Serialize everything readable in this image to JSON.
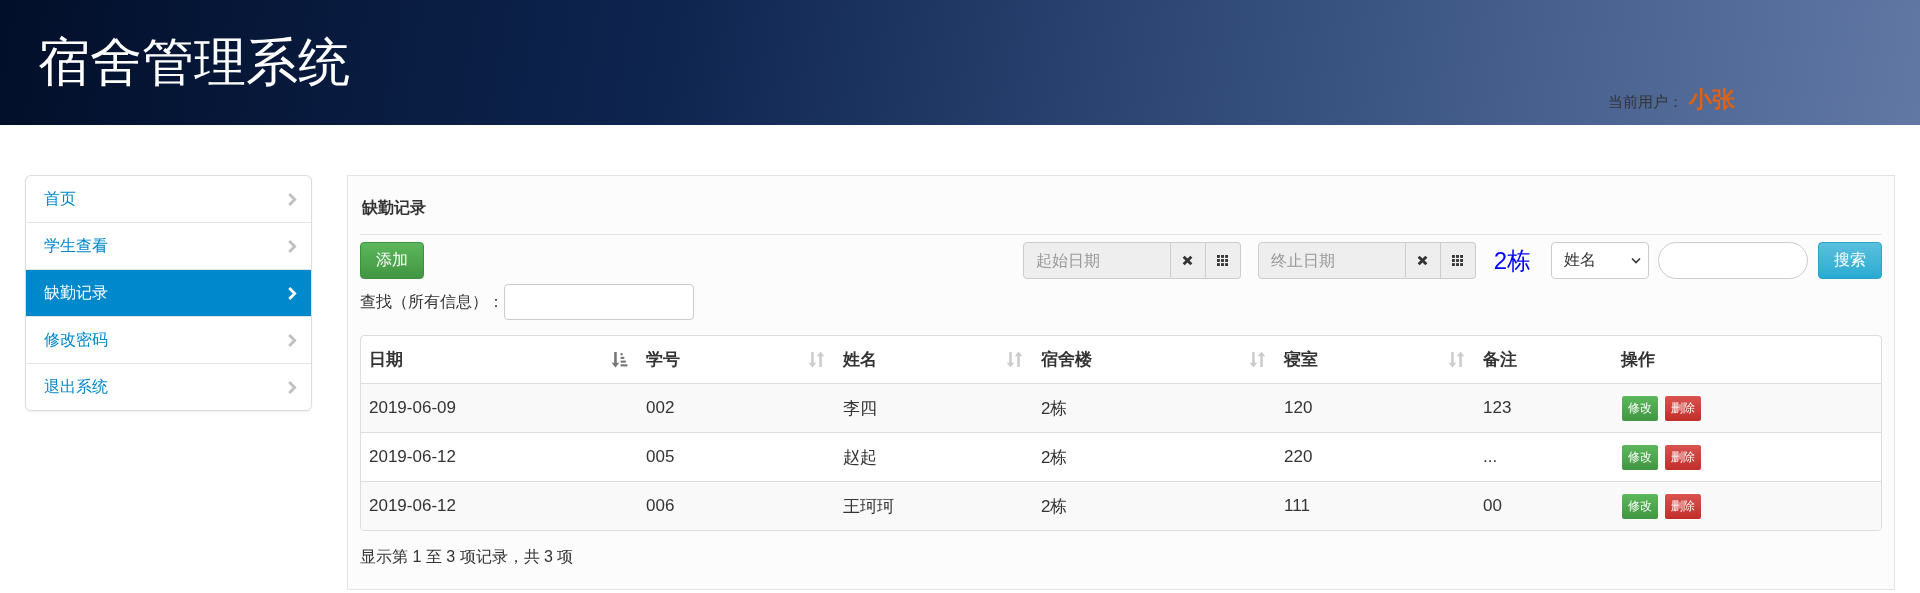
{
  "header": {
    "title": "宿舍管理系统",
    "user_label": "当前用户：",
    "user_name": "小张"
  },
  "sidebar": {
    "items": [
      {
        "label": "首页",
        "selected": false
      },
      {
        "label": "学生查看",
        "selected": false
      },
      {
        "label": "缺勤记录",
        "selected": true
      },
      {
        "label": "修改密码",
        "selected": false
      },
      {
        "label": "退出系统",
        "selected": false
      }
    ]
  },
  "panel": {
    "title": "缺勤记录",
    "add_button": "添加",
    "start_date": {
      "placeholder": "起始日期"
    },
    "end_date": {
      "placeholder": "终止日期"
    },
    "building": "2栋",
    "search_by": "姓名",
    "search_button": "搜索",
    "find_label": "查找（所有信息）：",
    "table": {
      "columns": [
        {
          "label": "日期",
          "sorted": true
        },
        {
          "label": "学号",
          "sorted": false
        },
        {
          "label": "姓名",
          "sorted": false
        },
        {
          "label": "宿舍楼",
          "sorted": false
        },
        {
          "label": "寝室",
          "sorted": false
        },
        {
          "label": "备注"
        },
        {
          "label": "操作"
        }
      ],
      "rows": [
        {
          "cells": [
            "2019-06-09",
            "002",
            "李四",
            "2栋",
            "120",
            "123"
          ],
          "actions": [
            "修改",
            "删除"
          ]
        },
        {
          "cells": [
            "2019-06-12",
            "005",
            "赵起",
            "2栋",
            "220",
            "..."
          ],
          "actions": [
            "修改",
            "删除"
          ]
        },
        {
          "cells": [
            "2019-06-12",
            "006",
            "王珂珂",
            "2栋",
            "111",
            "00"
          ],
          "actions": [
            "修改",
            "删除"
          ]
        }
      ]
    },
    "footer": "显示第 1 至 3 项记录，共 3 项"
  }
}
